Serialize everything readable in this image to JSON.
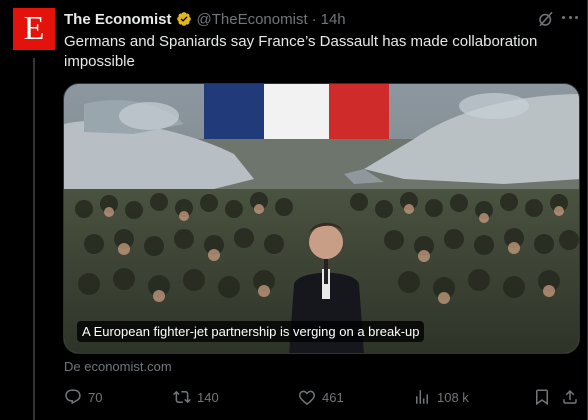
{
  "account": {
    "avatar_letter": "E",
    "display_name": "The Economist",
    "handle": "@TheEconomist",
    "separator": "·",
    "time": "14h",
    "verified_badge_color": "#e2b719",
    "avatar_color": "#e3120b"
  },
  "tweet": {
    "text": "Germans and Spaniards say France’s Dassault has made collaboration impossible"
  },
  "card": {
    "caption": "A European fighter-jet partnership is verging on a break-up",
    "source": "De economist.com"
  },
  "actions": {
    "replies": "70",
    "reposts": "140",
    "likes": "461",
    "views": "108 k"
  },
  "icons": [
    "verified-badge-icon",
    "grok-icon",
    "more-icon",
    "reply-icon",
    "retweet-icon",
    "like-icon",
    "views-icon",
    "bookmark-icon",
    "share-icon"
  ]
}
